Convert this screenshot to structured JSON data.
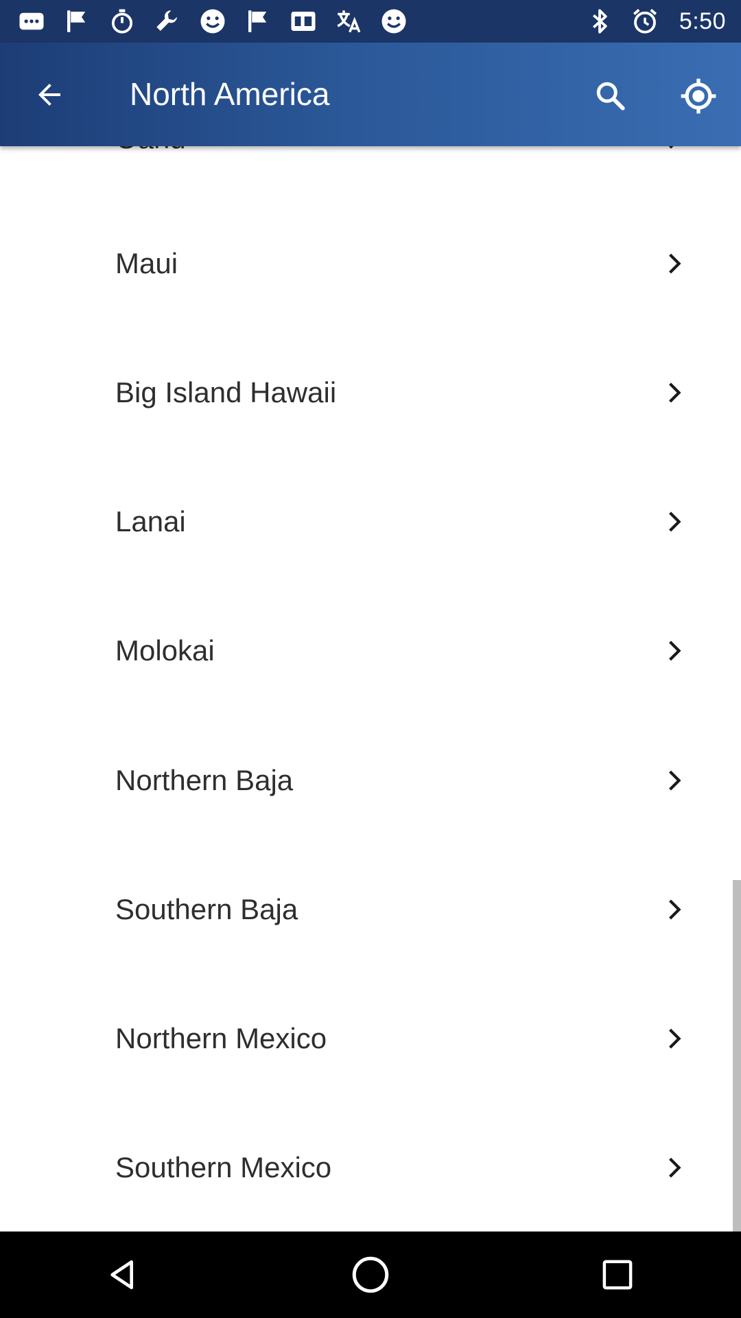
{
  "status_bar": {
    "time": "5:50",
    "left_icons": [
      "messages-icon",
      "flag-icon",
      "stopwatch-icon",
      "wrench-icon",
      "smiley-icon",
      "flag-icon",
      "qq-icon",
      "translate-icon",
      "smiley-icon"
    ],
    "right_icons": [
      "bluetooth-icon",
      "alarm-icon"
    ]
  },
  "app_bar": {
    "title": "North America",
    "back_icon": "arrow-back-icon",
    "search_icon": "search-icon",
    "location_icon": "my-location-icon"
  },
  "list": {
    "items": [
      {
        "label": "Oahu"
      },
      {
        "label": "Maui"
      },
      {
        "label": "Big Island Hawaii"
      },
      {
        "label": "Lanai"
      },
      {
        "label": "Molokai"
      },
      {
        "label": "Northern Baja"
      },
      {
        "label": "Southern Baja"
      },
      {
        "label": "Northern Mexico"
      },
      {
        "label": "Southern Mexico"
      }
    ]
  },
  "nav_bar": {
    "buttons": [
      "back-triangle-icon",
      "home-circle-icon",
      "recents-square-icon"
    ]
  },
  "colors": {
    "status_bar": "#1b3566",
    "app_bar_start": "#1d3d76",
    "app_bar_end": "#3a6db3",
    "text": "#2e2e2e",
    "nav_bar": "#000000"
  }
}
